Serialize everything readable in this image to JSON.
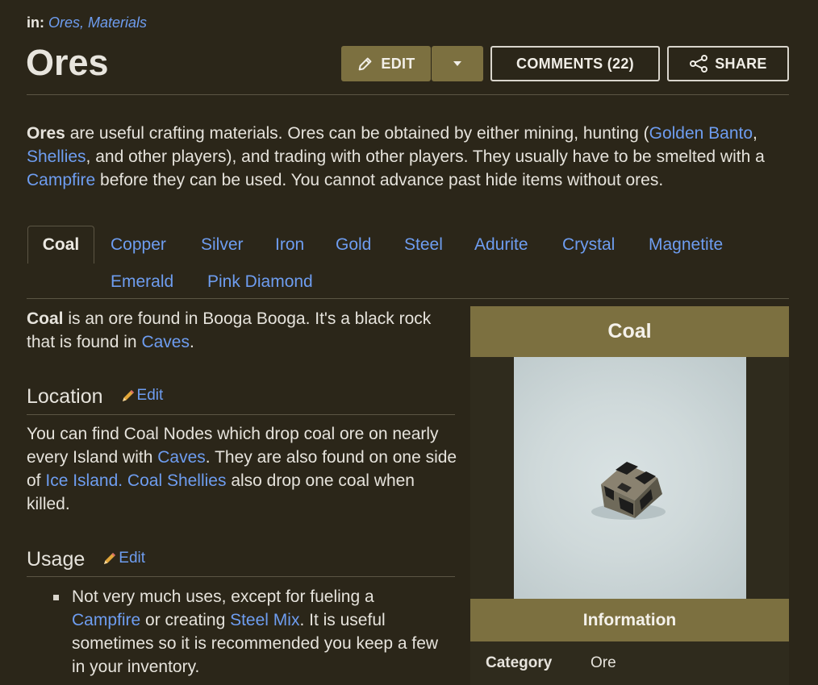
{
  "breadcrumb": {
    "label": "in:",
    "categories": "Ores, Materials"
  },
  "page_title": "Ores",
  "actions": {
    "edit": "EDIT",
    "comments": "COMMENTS (22)",
    "share": "SHARE"
  },
  "intro": {
    "t1": "Ores",
    "t2": " are useful crafting materials. Ores can be obtained by either mining, hunting (",
    "l1": "Golden Banto",
    "t3": ", ",
    "l2": "Shellies",
    "t4": ", and other players), and trading with other players. They usually have to be smelted with a ",
    "l3": "Campfire",
    "t5": " before they can be used. You cannot advance past hide items without ores."
  },
  "tabs": [
    "Coal",
    "Copper",
    "Silver",
    "Iron",
    "Gold",
    "Steel",
    "Adurite",
    "Crystal",
    "Magnetite",
    "Emerald",
    "Pink Diamond"
  ],
  "coal": {
    "t1": "Coal",
    "t2": " is an ore found in Booga Booga. It's a black rock that is found in ",
    "l1": "Caves",
    "t3": "."
  },
  "location": {
    "heading": "Location",
    "edit": "Edit",
    "t1": "You can find Coal Nodes which drop coal ore on nearly every Island with ",
    "l1": "Caves",
    "t2": ". They are also found on one side of ",
    "l2": "Ice Island. Coal Shellies",
    "t3": " also drop one coal when killed."
  },
  "usage": {
    "heading": "Usage",
    "edit": "Edit",
    "t1": "Not very much uses, except for fueling a ",
    "l1": "Campfire",
    "t2": " or creating ",
    "l2": "Steel Mix",
    "t3": ". It is useful sometimes so it is recommended you keep a few in your inventory."
  },
  "infobox": {
    "title": "Coal",
    "info_heading": "Information",
    "category_label": "Category",
    "category_value": "Ore"
  },
  "colors": {
    "accent": "#7c7040",
    "link": "#6e9df0",
    "background": "#2b2619"
  }
}
